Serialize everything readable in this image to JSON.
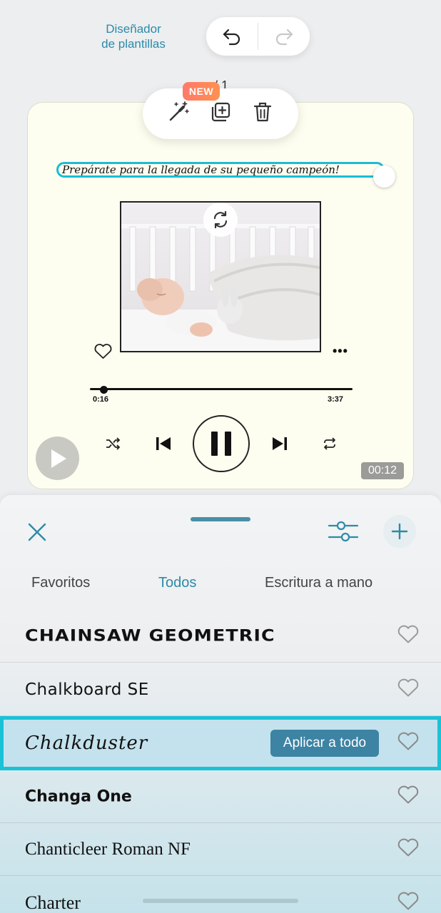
{
  "header": {
    "designer_line1": "Diseñador",
    "designer_line2": "de plantillas",
    "page_counter": "/ 1"
  },
  "toolbar": {
    "new_badge": "NEW"
  },
  "canvas": {
    "caption": "Prepárate para la llegada de su pequeño campeón!",
    "player": {
      "elapsed": "0:16",
      "total": "3:37",
      "progress_fraction": 0.07
    },
    "video_duration": "00:12"
  },
  "sheet": {
    "tabs": [
      {
        "label": "Favoritos",
        "active": false
      },
      {
        "label": "Todos",
        "active": true
      },
      {
        "label": "Escritura a mano",
        "active": false
      }
    ],
    "fonts": [
      {
        "name": "CHAINSAW GEOMETRIC"
      },
      {
        "name": "Chalkboard SE"
      },
      {
        "name": "Chalkduster",
        "selected": true
      },
      {
        "name": "Changa One"
      },
      {
        "name": "Chanticleer Roman NF"
      },
      {
        "name": "Charter"
      }
    ],
    "apply_all_label": "Aplicar a todo"
  },
  "colors": {
    "accent": "#2e8aa8",
    "selection": "#19c2d6",
    "button_blue": "#3d83a3"
  }
}
